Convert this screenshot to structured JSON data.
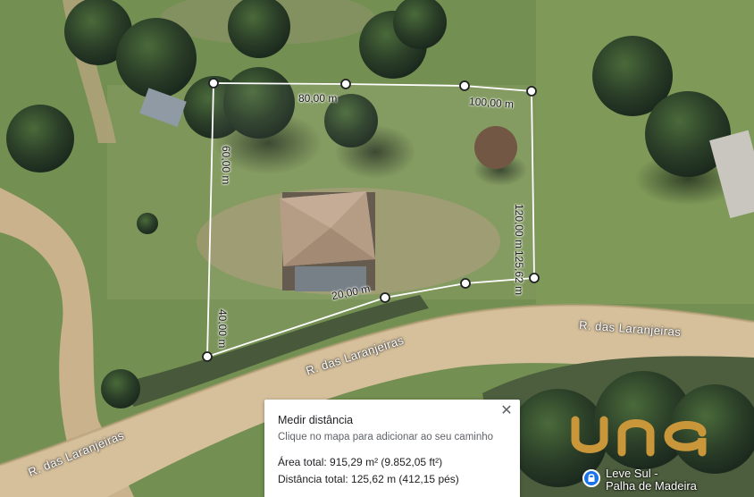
{
  "map": {
    "segment_labels": [
      "80,00 m",
      "100,00 m",
      "60,00 m",
      "120,00 m",
      "125,62 m",
      "20,00 m",
      "40,00 m"
    ],
    "road_labels": [
      "R. das Laranjeiras",
      "R. das Laranjeiras",
      "R. das Laranjeiras"
    ],
    "polygon_color": "#ffffff",
    "vertex_fill": "#ffffff",
    "vertex_stroke": "#202124"
  },
  "measure_card": {
    "title": "Medir distância",
    "subtitle": "Clique no mapa para adicionar ao seu caminho",
    "area": "Área total: 915,29 m² (9.852,05 ft²)",
    "distance": "Distância total: 125,62 m (412,15 pés)",
    "close_icon": "close-icon"
  },
  "watermark": {
    "text": "una",
    "color": "#c9973a"
  },
  "place_marker": {
    "line1": "Leve Sul -",
    "line2": "Palha de Madeira",
    "icon": "lock-pin-icon"
  }
}
